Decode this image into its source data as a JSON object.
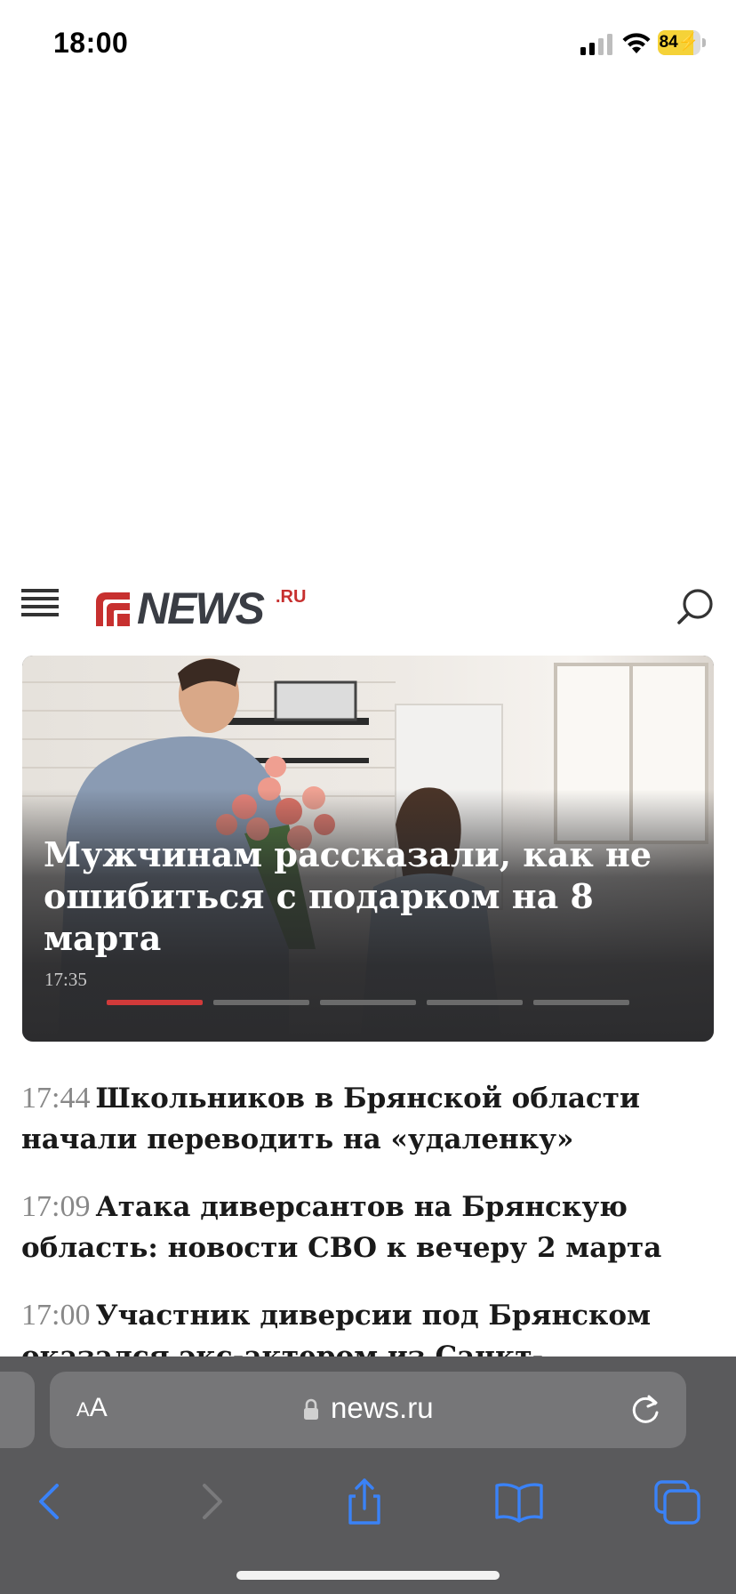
{
  "status_bar": {
    "time": "18:00",
    "battery": "84",
    "battery_level": 0.84,
    "icons": [
      "signal-icon",
      "wifi-icon",
      "battery-charging-icon"
    ]
  },
  "header": {
    "logo_word": "NEWS",
    "logo_tld": ".RU",
    "logo_color": "#c7302f",
    "menu_icon": "hamburger-menu-icon",
    "search_icon": "search-icon"
  },
  "hero": {
    "title": "Мужчинам рассказали, как не ошибиться с подарком на 8 марта",
    "time": "17:35",
    "slides_total": 5,
    "active_slide": 1,
    "accent_color": "#d13a3a"
  },
  "news": [
    {
      "time": "17:44",
      "title": "Школьников в Брянской области начали переводить на «удаленку»"
    },
    {
      "time": "17:09",
      "title": "Атака диверсантов на Брянскую область: новости СВО к вечеру 2 марта"
    },
    {
      "time": "17:00",
      "title": "Участник диверсии под Брянском оказался экс-актером из Санкт-"
    }
  ],
  "browser": {
    "aa_small": "A",
    "aa_big": "A",
    "url": "news.ru",
    "icons": [
      "back-icon",
      "forward-icon",
      "share-icon",
      "bookmarks-icon",
      "tabs-icon",
      "reload-icon",
      "lock-icon"
    ]
  }
}
